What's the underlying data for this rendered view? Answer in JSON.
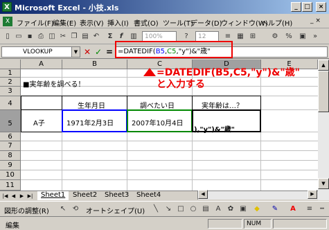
{
  "window": {
    "title": "Microsoft Excel - 小技.xls"
  },
  "menu": [
    "ファイル(F)",
    "編集(E)",
    "表示(V)",
    "挿入(I)",
    "書式(O)",
    "ツール(T)",
    "データ(D)",
    "ウィンドウ(W)",
    "ヘルプ(H)"
  ],
  "toolbar": {
    "zoom": "100%",
    "font_size": "12"
  },
  "formula_bar": {
    "name_box": "VLOOKUP",
    "formula_parts": [
      "=DATEDIF(",
      "B5",
      ",",
      "C5",
      ",\"y\")&\"歳\""
    ]
  },
  "columns": [
    "A",
    "B",
    "C",
    "D",
    "E"
  ],
  "rows": [
    "1",
    "2",
    "3",
    "4",
    "5",
    "6",
    "7",
    "8",
    "9",
    "10",
    "11"
  ],
  "cells": {
    "A2": "■実年齢を調べる！",
    "B4": "生年月日",
    "C4": "調べたい日",
    "D4": "実年齢は…？",
    "A5": "A子",
    "B5": "1971年2月3日",
    "C5": "2007年10月4日",
    "D5": "),\"y\")&\"歳\""
  },
  "callout": {
    "line1": "=DATEDIF(B5,C5,\"y\")&\"歳\"",
    "line2": "と入力する"
  },
  "sheets": [
    "Sheet1",
    "Sheet2",
    "Sheet3",
    "Sheet4"
  ],
  "drawing_bar": {
    "draw_label": "図形の調整(R)",
    "autoshape_label": "オートシェイプ(U)"
  },
  "status": {
    "mode": "編集",
    "num": "NUM"
  },
  "colors": {
    "highlight": "#e00000",
    "cell_ref_b": "#0000ff",
    "cell_ref_c": "#008000"
  }
}
